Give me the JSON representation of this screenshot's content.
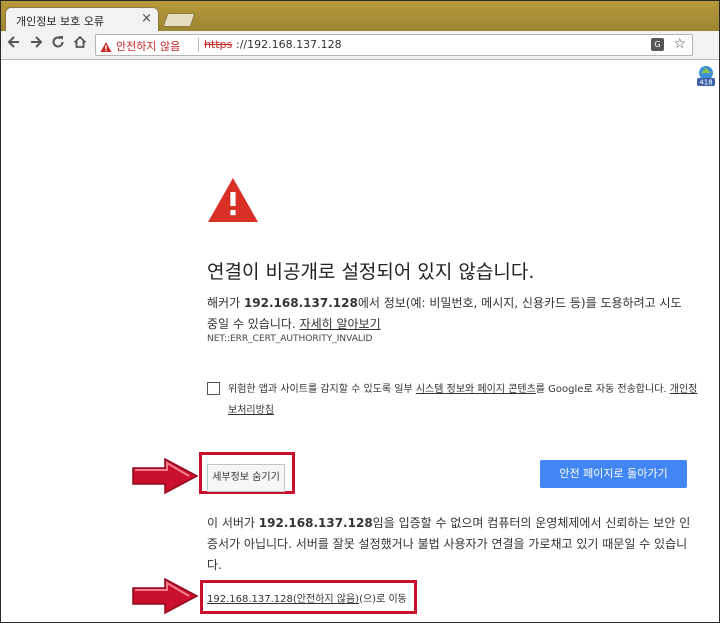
{
  "browser": {
    "tab": {
      "title": "개인정보 보호 오류",
      "close": "×"
    },
    "toolbar": {
      "security_label": "안전하지 않음",
      "scheme": "https",
      "url_rest": "://192.168.137.128",
      "extension_badge": "418"
    }
  },
  "page": {
    "heading": "연결이 비공개로 설정되어 있지 않습니다.",
    "intro": {
      "p1": "해커가 ",
      "host": "192.168.137.128",
      "p2": "에서 정보(예: 비밀번호, 메시지, 신용카드 등)를 도용하려고 시도중일 수 있습니다. ",
      "learn_more": "자세히 알아보기"
    },
    "error_code": "NET::ERR_CERT_AUTHORITY_INVALID",
    "optin": {
      "p1": "위험한 앱과 사이트를 감지할 수 있도록 일부 ",
      "link": "시스템 정보와 페이지 콘텐츠",
      "p2": "를 Google로 자동 전송합니다. ",
      "privacy_link": "개인정보처리방침"
    },
    "details_button": "세부정보 숨기기",
    "back_button": "안전 페이지로 돌아가기",
    "details": {
      "p1": "이 서버가 ",
      "host": "192.168.137.128",
      "p2": "임을 입증할 수 없으며 컴퓨터의 운영체제에서 신뢰하는 보안 인증서가 아닙니다. 서버를 잘못 설정했거나 불법 사용자가 연결을 가로채고 있기 때문일 수 있습니다."
    },
    "proceed": {
      "link": "192.168.137.128(안전하지 않음)",
      "suffix": "(으)로 이동"
    }
  },
  "colors": {
    "accent_blue": "#4285f4",
    "warning_red": "#d93025",
    "highlight_red": "#c8102e"
  }
}
